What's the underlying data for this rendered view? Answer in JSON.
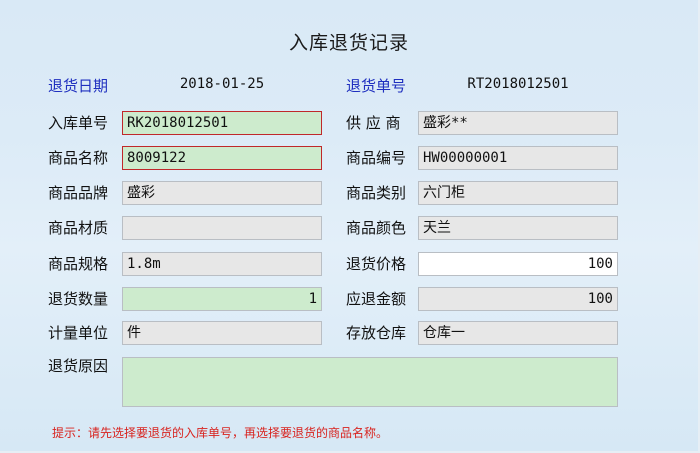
{
  "title": "入库退货记录",
  "left": {
    "return_date": {
      "label": "退货日期",
      "value": "2018-01-25"
    },
    "inbound_no": {
      "label": "入库单号",
      "value": "RK2018012501"
    },
    "product_name": {
      "label": "商品名称",
      "value": "8009122"
    },
    "brand": {
      "label": "商品品牌",
      "value": "盛彩"
    },
    "material": {
      "label": "商品材质",
      "value": ""
    },
    "spec": {
      "label": "商品规格",
      "value": "1.8m"
    },
    "quantity": {
      "label": "退货数量",
      "value": "1"
    },
    "unit": {
      "label": "计量单位",
      "value": "件"
    },
    "reason": {
      "label": "退货原因",
      "value": ""
    }
  },
  "right": {
    "return_no": {
      "label": "退货单号",
      "value": "RT2018012501"
    },
    "supplier": {
      "label": "供 应 商",
      "value": "盛彩**"
    },
    "product_code": {
      "label": "商品编号",
      "value": "HW00000001"
    },
    "category": {
      "label": "商品类别",
      "value": "六门柜"
    },
    "color": {
      "label": "商品颜色",
      "value": "天兰"
    },
    "price": {
      "label": "退货价格",
      "value": "100"
    },
    "refund": {
      "label": "应退金额",
      "value": "100"
    },
    "warehouse": {
      "label": "存放仓库",
      "value": "仓库一"
    }
  },
  "hint": "提示：请先选择要退货的入库单号，再选择要退货的商品名称。",
  "colors": {
    "label_blue": "#1f2fbf",
    "hint_red": "#d8231f",
    "field_green": "#cdebcd",
    "field_gray": "#e7e7e7"
  }
}
